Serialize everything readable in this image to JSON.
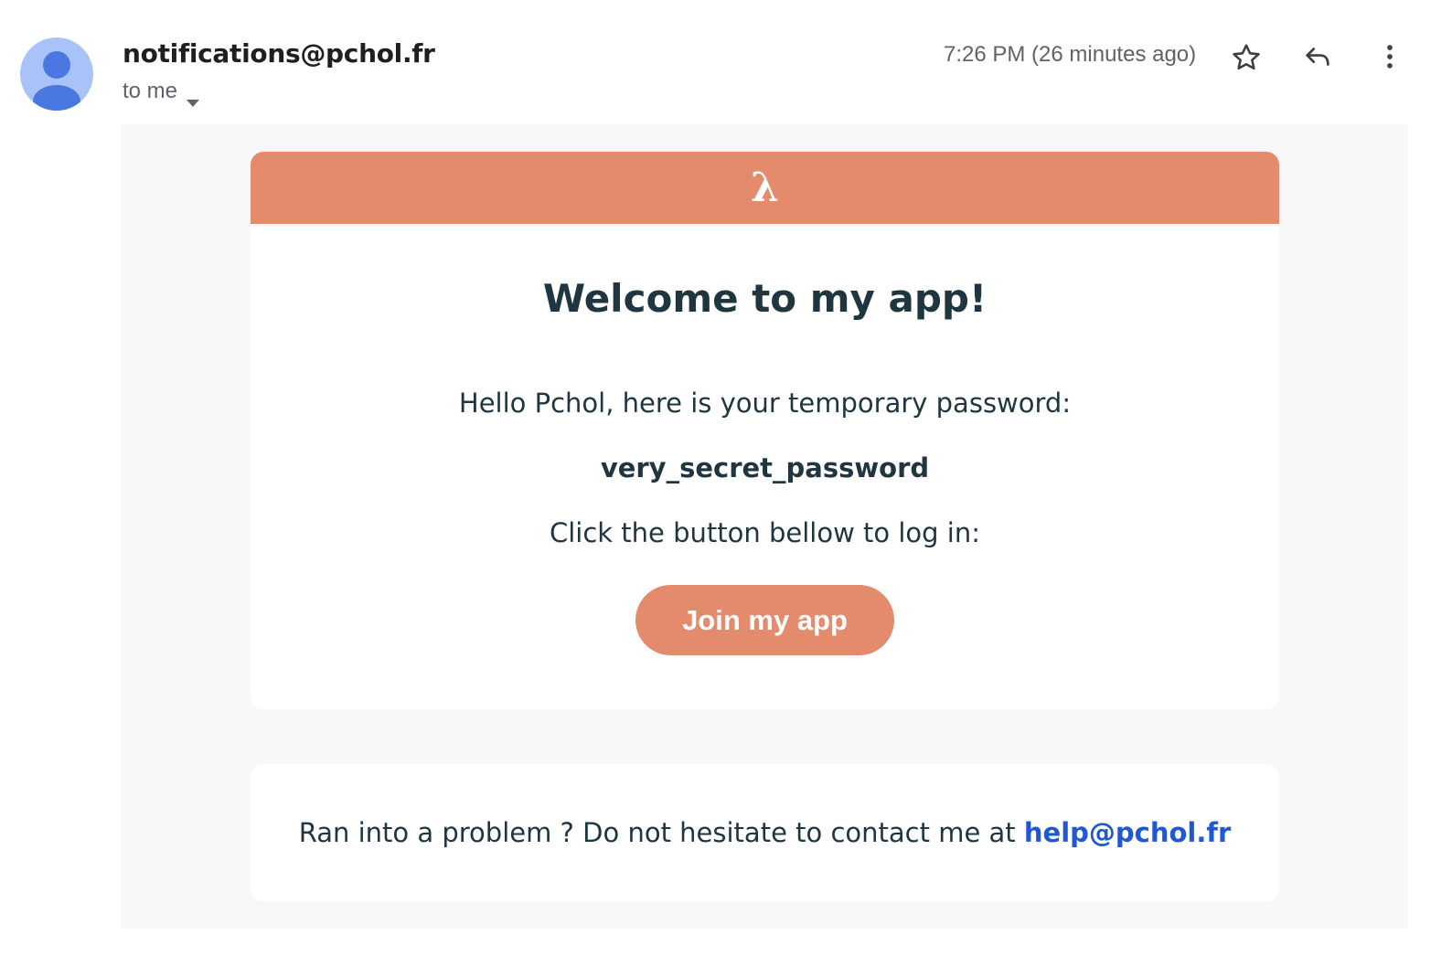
{
  "header": {
    "sender": "notifications@pchol.fr",
    "recipient_label": "to me",
    "timestamp": "7:26 PM (26 minutes ago)",
    "icons": [
      "avatar-icon",
      "chevron-down-icon",
      "star-icon",
      "reply-icon",
      "more-vert-icon"
    ]
  },
  "email": {
    "logo": "λ",
    "title": "Welcome to my app!",
    "greeting": "Hello Pchol, here is your temporary password:",
    "password": "very_secret_password",
    "instruction": "Click the button bellow to log in:",
    "button_label": "Join my app",
    "footer_text": "Ran into a problem ? Do not hesitate to contact me at",
    "footer_link": "help@pchol.fr"
  },
  "colors": {
    "accent": "#e48b6e",
    "text_dark": "#1f3640",
    "link": "#2057d3",
    "body_bg": "#f8f8f8",
    "avatar_bg": "#a8c3f7",
    "avatar_fg": "#4a78e0"
  }
}
